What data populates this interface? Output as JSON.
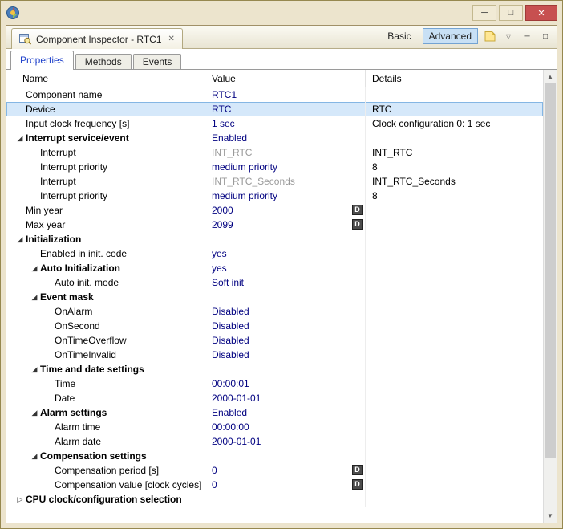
{
  "colors": {
    "frame": "#ece4cd",
    "frame_border": "#96884f",
    "close_button": "#c75050",
    "selection_bg": "#d5e8fa",
    "selection_border": "#84b6e4",
    "value_text": "#000080",
    "muted_value_text": "#9a9a9a",
    "advanced_toggle_bg": "#c8e0f5",
    "advanced_toggle_border": "#74a3d2",
    "active_subtab_text": "#2244cc"
  },
  "titlebar": {
    "minimize_glyph": "─",
    "maximize_glyph": "□",
    "close_glyph": "✕"
  },
  "editor_tab": {
    "label": "Component Inspector - RTC1",
    "close_glyph": "✕"
  },
  "view_toolbar": {
    "basic_label": "Basic",
    "advanced_label": "Advanced",
    "menu_glyph": "▽",
    "minimize_glyph": "─",
    "maximize_glyph": "□"
  },
  "subtabs": [
    {
      "label": "Properties",
      "active": true
    },
    {
      "label": "Methods",
      "active": false
    },
    {
      "label": "Events",
      "active": false
    }
  ],
  "table": {
    "columns": [
      "Name",
      "Value",
      "Details"
    ],
    "glyphs": {
      "expanded": "◢",
      "collapsed": "▷",
      "d_button": "D"
    },
    "rows": [
      {
        "level": 0,
        "arrow": null,
        "bold": false,
        "name": "Component name",
        "value": "RTC1",
        "details": "",
        "selected": false
      },
      {
        "level": 0,
        "arrow": null,
        "bold": false,
        "name": "Device",
        "value": "RTC",
        "details": "RTC",
        "selected": true
      },
      {
        "level": 0,
        "arrow": null,
        "bold": false,
        "name": "Input clock frequency [s]",
        "value": "1 sec",
        "details": "Clock configuration 0: 1 sec",
        "selected": false
      },
      {
        "level": 0,
        "arrow": "expanded",
        "bold": true,
        "name": "Interrupt service/event",
        "value": "Enabled",
        "details": "",
        "selected": false
      },
      {
        "level": 1,
        "arrow": null,
        "bold": false,
        "name": "Interrupt",
        "value": "INT_RTC",
        "value_muted": true,
        "details": "INT_RTC",
        "selected": false
      },
      {
        "level": 1,
        "arrow": null,
        "bold": false,
        "name": "Interrupt priority",
        "value": "medium priority",
        "details": "8",
        "selected": false
      },
      {
        "level": 1,
        "arrow": null,
        "bold": false,
        "name": "Interrupt",
        "value": "INT_RTC_Seconds",
        "value_muted": true,
        "details": "INT_RTC_Seconds",
        "selected": false
      },
      {
        "level": 1,
        "arrow": null,
        "bold": false,
        "name": "Interrupt priority",
        "value": "medium priority",
        "details": "8",
        "selected": false
      },
      {
        "level": 0,
        "arrow": null,
        "bold": false,
        "name": "Min year",
        "value": "2000",
        "d_button": true,
        "details": "",
        "selected": false
      },
      {
        "level": 0,
        "arrow": null,
        "bold": false,
        "name": "Max year",
        "value": "2099",
        "d_button": true,
        "details": "",
        "selected": false
      },
      {
        "level": 0,
        "arrow": "expanded",
        "bold": true,
        "name": "Initialization",
        "value": "",
        "details": "",
        "selected": false
      },
      {
        "level": 1,
        "arrow": null,
        "bold": false,
        "name": "Enabled in init. code",
        "value": "yes",
        "details": "",
        "selected": false
      },
      {
        "level": 1,
        "arrow": "expanded",
        "bold": true,
        "name": "Auto Initialization",
        "value": "yes",
        "details": "",
        "selected": false
      },
      {
        "level": 2,
        "arrow": null,
        "bold": false,
        "name": "Auto init. mode",
        "value": "Soft init",
        "details": "",
        "selected": false
      },
      {
        "level": 1,
        "arrow": "expanded",
        "bold": true,
        "name": "Event mask",
        "value": "",
        "details": "",
        "selected": false
      },
      {
        "level": 2,
        "arrow": null,
        "bold": false,
        "name": "OnAlarm",
        "value": "Disabled",
        "details": "",
        "selected": false
      },
      {
        "level": 2,
        "arrow": null,
        "bold": false,
        "name": "OnSecond",
        "value": "Disabled",
        "details": "",
        "selected": false
      },
      {
        "level": 2,
        "arrow": null,
        "bold": false,
        "name": "OnTimeOverflow",
        "value": "Disabled",
        "details": "",
        "selected": false
      },
      {
        "level": 2,
        "arrow": null,
        "bold": false,
        "name": "OnTimeInvalid",
        "value": "Disabled",
        "details": "",
        "selected": false
      },
      {
        "level": 1,
        "arrow": "expanded",
        "bold": true,
        "name": "Time and date settings",
        "value": "",
        "details": "",
        "selected": false
      },
      {
        "level": 2,
        "arrow": null,
        "bold": false,
        "name": "Time",
        "value": "00:00:01",
        "details": "",
        "selected": false
      },
      {
        "level": 2,
        "arrow": null,
        "bold": false,
        "name": "Date",
        "value": "2000-01-01",
        "details": "",
        "selected": false
      },
      {
        "level": 1,
        "arrow": "expanded",
        "bold": true,
        "name": "Alarm settings",
        "value": "Enabled",
        "details": "",
        "selected": false
      },
      {
        "level": 2,
        "arrow": null,
        "bold": false,
        "name": "Alarm time",
        "value": "00:00:00",
        "details": "",
        "selected": false
      },
      {
        "level": 2,
        "arrow": null,
        "bold": false,
        "name": "Alarm date",
        "value": "2000-01-01",
        "details": "",
        "selected": false
      },
      {
        "level": 1,
        "arrow": "expanded",
        "bold": true,
        "name": "Compensation settings",
        "value": "",
        "details": "",
        "selected": false
      },
      {
        "level": 2,
        "arrow": null,
        "bold": false,
        "name": "Compensation period [s]",
        "value": "0",
        "d_button": true,
        "details": "",
        "selected": false
      },
      {
        "level": 2,
        "arrow": null,
        "bold": false,
        "name": "Compensation value [clock cycles]",
        "value": "0",
        "d_button": true,
        "details": "",
        "selected": false
      },
      {
        "level": 0,
        "arrow": "collapsed",
        "bold": true,
        "name": "CPU clock/configuration selection",
        "value": "",
        "details": "",
        "selected": false
      }
    ]
  },
  "scrollbar": {
    "up_glyph": "▲",
    "down_glyph": "▼"
  }
}
